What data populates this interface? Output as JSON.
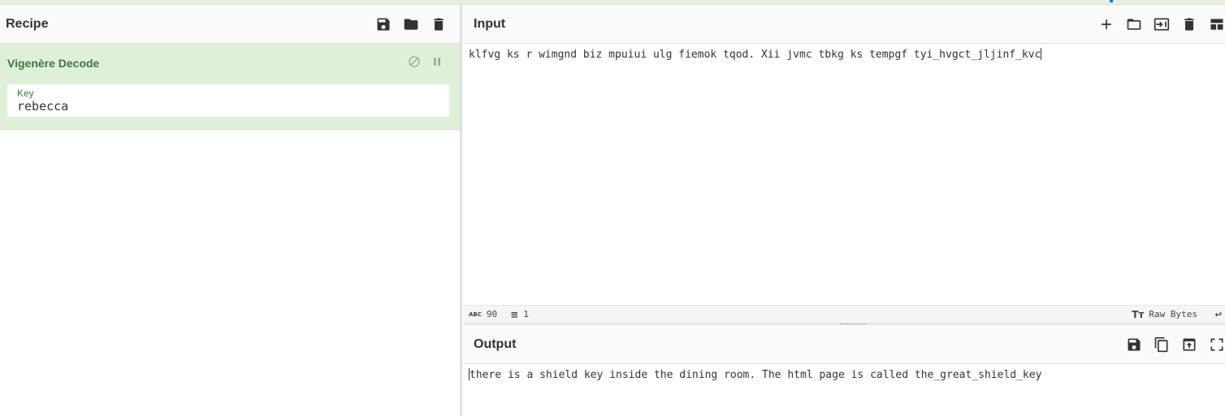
{
  "recipe": {
    "title": "Recipe",
    "icons": [
      "save-icon",
      "folder-icon",
      "trash-icon"
    ],
    "operation": {
      "name": "Vigenère Decode",
      "arg_label": "Key",
      "arg_value": "rebecca"
    }
  },
  "input": {
    "title": "Input",
    "icons": [
      "plus-icon",
      "folder-icon",
      "import-icon",
      "trash-icon",
      "layout-icon"
    ],
    "text": "klfvg ks r wimgnd biz mpuiui ulg fiemok tqod. Xii jvmc tbkg ks tempgf tyi_hvgct_jljinf_kvc",
    "status": {
      "length_icon": "ABC",
      "length": "90",
      "lines": "1",
      "encoding": "Raw Bytes"
    }
  },
  "output": {
    "title": "Output",
    "icons": [
      "save-icon",
      "copy-icon",
      "replace-input-icon",
      "fullscreen-icon"
    ],
    "text": "there is a shield key inside the dining room. The html page is called the_great_shield_key"
  },
  "colors": {
    "op_background": "#dff0d8",
    "op_text": "#3c763d"
  }
}
